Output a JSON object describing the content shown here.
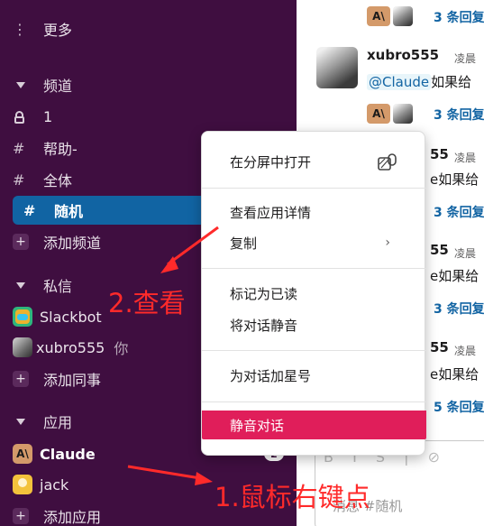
{
  "sidebar": {
    "more": "更多",
    "channels_header": "频道",
    "channels": [
      {
        "prefix": "lock",
        "label": "1"
      },
      {
        "prefix": "#",
        "label": "帮助-"
      },
      {
        "prefix": "#",
        "label": "全体"
      },
      {
        "prefix": "#",
        "label": "随机",
        "active": true
      }
    ],
    "add_channel": "添加频道",
    "dm_header": "私信",
    "dms": [
      {
        "label": "Slackbot",
        "suffix": ""
      },
      {
        "label": "xubro555",
        "suffix": "你"
      }
    ],
    "add_coworker": "添加同事",
    "apps_header": "应用",
    "apps": [
      {
        "label": "Claude",
        "badge": "2"
      },
      {
        "label": "jack"
      }
    ],
    "add_app": "添加应用",
    "colors": {
      "bg": "#3f0e40",
      "active": "#1164a3"
    }
  },
  "messages": {
    "user": "xubro555",
    "time": "凌晨",
    "mention": "@Claude",
    "text": "如果给",
    "replies": [
      "3 条回复",
      "3 条回复",
      "3 条回复",
      "3 条回复",
      "3 条回复",
      "5 条回复"
    ],
    "partial_user": "55",
    "partial_line": "e如果给"
  },
  "composer": {
    "toolbar": "B I S | ⊘",
    "placeholder": "消息 #随机"
  },
  "context_menu": {
    "items": [
      {
        "label": "在分屏中打开",
        "icon": "split-view-icon"
      },
      {
        "label": "查看应用详情"
      },
      {
        "label": "复制",
        "submenu": true
      },
      {
        "label": "标记为已读"
      },
      {
        "label": "将对话静音"
      },
      {
        "label": "为对话加星号"
      },
      {
        "label": "静音对话",
        "danger": true
      }
    ],
    "chevron": "›",
    "danger_color": "#e01e5a"
  },
  "annotations": {
    "step1": "1.鼠标右键点",
    "step2": "2.查看",
    "color": "#ff2a2a"
  }
}
